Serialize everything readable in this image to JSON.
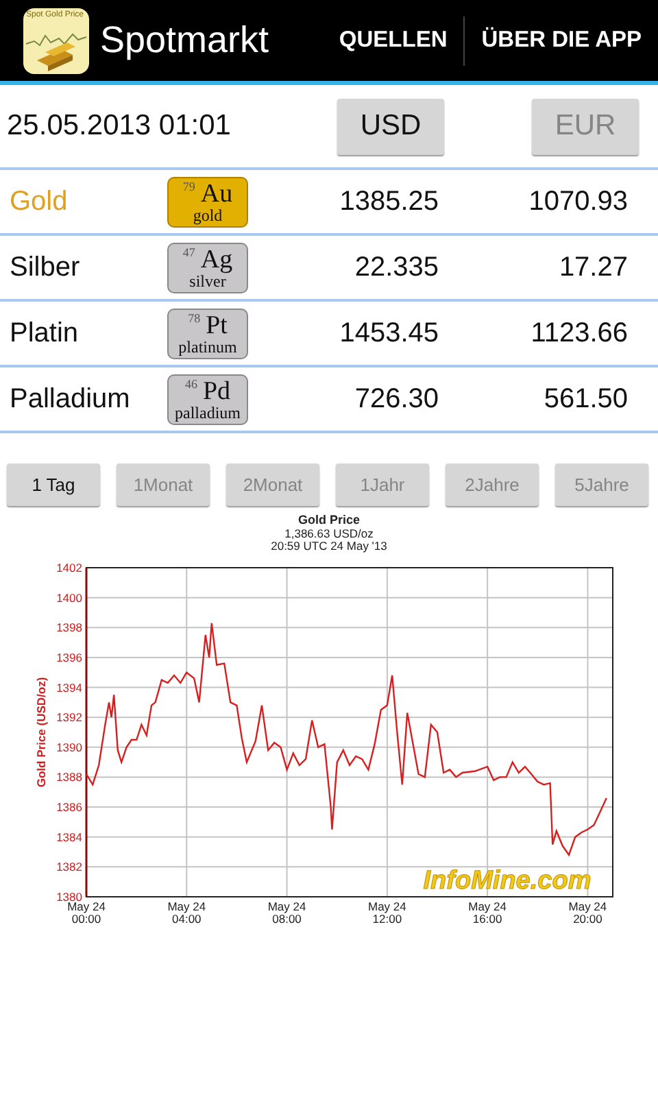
{
  "action_bar": {
    "icon_caption": "Spot Gold Price",
    "title": "Spotmarkt",
    "actions": [
      "QUELLEN",
      "ÜBER DIE APP"
    ]
  },
  "timestamp": "25.05.2013 01:01",
  "currencies": [
    {
      "label": "USD",
      "selected": true
    },
    {
      "label": "EUR",
      "selected": false
    }
  ],
  "metals": [
    {
      "name": "Gold",
      "number": "79",
      "symbol": "Au",
      "element": "gold",
      "usd": "1385.25",
      "eur": "1070.93",
      "selected": true
    },
    {
      "name": "Silber",
      "number": "47",
      "symbol": "Ag",
      "element": "silver",
      "usd": "22.335",
      "eur": "17.27",
      "selected": false
    },
    {
      "name": "Platin",
      "number": "78",
      "symbol": "Pt",
      "element": "platinum",
      "usd": "1453.45",
      "eur": "1123.66",
      "selected": false
    },
    {
      "name": "Palladium",
      "number": "46",
      "symbol": "Pd",
      "element": "palladium",
      "usd": "726.30",
      "eur": "561.50",
      "selected": false
    }
  ],
  "ranges": [
    {
      "label": "1 Tag",
      "selected": true
    },
    {
      "label": "1Monat",
      "selected": false
    },
    {
      "label": "2Monat",
      "selected": false
    },
    {
      "label": "1Jahr",
      "selected": false
    },
    {
      "label": "2Jahre",
      "selected": false
    },
    {
      "label": "5Jahre",
      "selected": false
    }
  ],
  "chart": {
    "xtick_dates": [
      "May 24",
      "May 24",
      "May 24",
      "May 24",
      "May 24",
      "May 24"
    ],
    "subtitle": [
      "1,386.63 USD/oz",
      "20:59 UTC  24 May '13"
    ],
    "logo": "InfoMine.com",
    "chart_data": {
      "type": "line",
      "title": "Gold Price",
      "ylabel": "Gold Price (USD/oz)",
      "x": [
        0,
        0.25,
        0.5,
        0.75,
        0.9,
        1.0,
        1.1,
        1.25,
        1.4,
        1.6,
        1.8,
        2.0,
        2.2,
        2.4,
        2.6,
        2.75,
        3.0,
        3.25,
        3.5,
        3.75,
        4.0,
        4.3,
        4.5,
        4.75,
        4.9,
        5.0,
        5.2,
        5.5,
        5.75,
        6.0,
        6.2,
        6.4,
        6.75,
        7.0,
        7.25,
        7.5,
        7.75,
        8.0,
        8.25,
        8.5,
        8.75,
        9.0,
        9.25,
        9.5,
        9.75,
        9.8,
        10.0,
        10.25,
        10.5,
        10.75,
        11.0,
        11.25,
        11.5,
        11.75,
        12.0,
        12.2,
        12.4,
        12.6,
        12.8,
        13.0,
        13.25,
        13.5,
        13.75,
        14.0,
        14.25,
        14.5,
        14.75,
        15.0,
        15.5,
        16.0,
        16.25,
        16.5,
        16.75,
        17.0,
        17.25,
        17.5,
        17.75,
        18.0,
        18.25,
        18.5,
        18.6,
        18.75,
        19.0,
        19.25,
        19.5,
        19.75,
        20.0,
        20.25,
        20.5,
        20.75
      ],
      "series": [
        {
          "color": "#d81e1e",
          "values": [
            1388.2,
            1387.5,
            1388.8,
            1391.5,
            1393,
            1392,
            1393.5,
            1389.8,
            1389,
            1390,
            1390.5,
            1390.5,
            1391.5,
            1390.8,
            1392.8,
            1393,
            1394.5,
            1394.3,
            1394.8,
            1394.3,
            1395,
            1394.6,
            1393,
            1397.5,
            1396,
            1398.3,
            1395.5,
            1395.6,
            1393,
            1392.8,
            1390.6,
            1389,
            1390.4,
            1392.8,
            1389.8,
            1390.3,
            1390,
            1388.5,
            1389.6,
            1388.8,
            1389.2,
            1391.8,
            1390,
            1390.2,
            1386,
            1384.5,
            1389,
            1389.8,
            1388.8,
            1389.4,
            1389.2,
            1388.5,
            1390.2,
            1392.5,
            1392.8,
            1394.8,
            1391,
            1387.5,
            1392.3,
            1390.5,
            1388.2,
            1388,
            1391.5,
            1391,
            1388.3,
            1388.5,
            1388,
            1388.3,
            1388.4,
            1388.7,
            1387.8,
            1388,
            1388,
            1389,
            1388.3,
            1388.7,
            1388.2,
            1387.7,
            1387.5,
            1387.6,
            1383.5,
            1384.4,
            1383.4,
            1382.8,
            1384,
            1384.3,
            1384.5,
            1384.8,
            1385.7,
            1386.6
          ]
        }
      ],
      "grid": true,
      "xlim": [
        0,
        21
      ],
      "ylim": [
        1380,
        1402
      ],
      "xticks": [
        {
          "value": 0,
          "label": "00:00"
        },
        {
          "value": 4,
          "label": "04:00"
        },
        {
          "value": 8,
          "label": "08:00"
        },
        {
          "value": 12,
          "label": "12:00"
        },
        {
          "value": 16,
          "label": "16:00"
        },
        {
          "value": 20,
          "label": "20:00"
        }
      ],
      "yticks": [
        1380,
        1382,
        1384,
        1386,
        1388,
        1390,
        1392,
        1394,
        1396,
        1398,
        1400,
        1402
      ]
    }
  }
}
